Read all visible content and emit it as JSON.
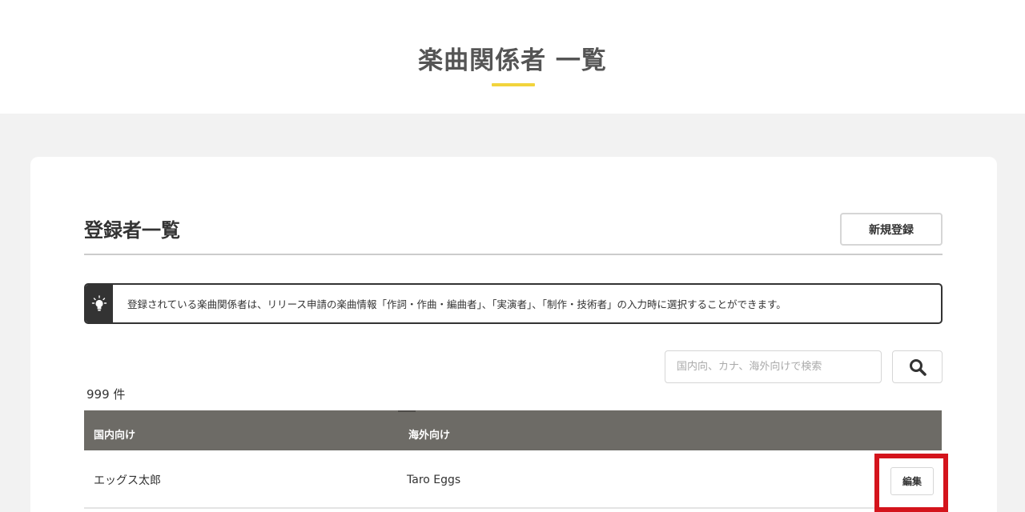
{
  "header": {
    "title": "楽曲関係者 一覧"
  },
  "section": {
    "title": "登録者一覧",
    "new_button_label": "新規登録"
  },
  "info": {
    "icon": "lightbulb-icon",
    "text": "登録されている楽曲関係者は、リリース申請の楽曲情報「作詞・作曲・編曲者」、「実演者」、「制作・技術者」の入力時に選択することができます。"
  },
  "search": {
    "placeholder": "国内向、カナ、海外向けで検索",
    "value": "",
    "icon": "search-icon"
  },
  "count": {
    "text": "999 件"
  },
  "table": {
    "headers": [
      "国内向け",
      "海外向け"
    ],
    "rows": [
      {
        "domestic": "エッグス太郎",
        "overseas": "Taro Eggs",
        "edit_label": "編集"
      }
    ]
  },
  "colors": {
    "accent_underline": "#f2d43c",
    "table_header": "#6d6b66",
    "highlight": "#d4141c",
    "page_background": "#f2f2f2"
  }
}
